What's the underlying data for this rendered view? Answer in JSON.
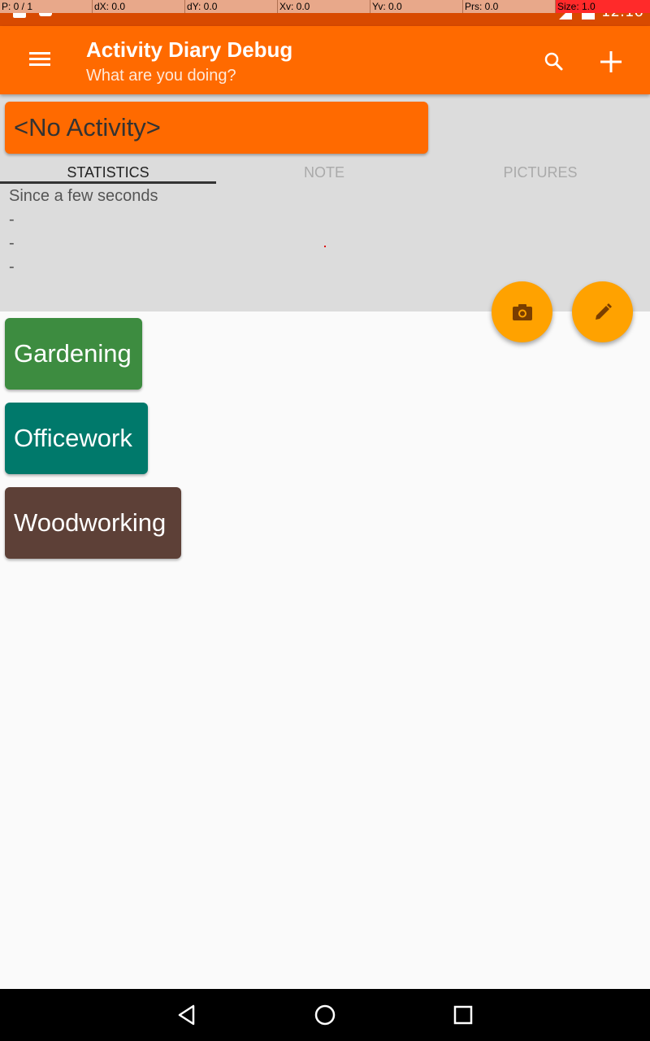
{
  "debug": {
    "cells": [
      "P: 0 / 1",
      "dX: 0.0",
      "dY: 0.0",
      "Xv: 0.0",
      "Yv: 0.0",
      "Prs: 0.0",
      "Size: 1.0"
    ]
  },
  "status_bar": {
    "time": "12:16"
  },
  "app_bar": {
    "title": "Activity Diary Debug",
    "subtitle": "What are you doing?",
    "menu_icon": "menu-icon",
    "search_icon": "search-icon",
    "add_icon": "add-icon"
  },
  "current": {
    "activity": "<No Activity>",
    "color": "#ff6a00"
  },
  "tabs": [
    {
      "label": "STATISTICS",
      "active": true
    },
    {
      "label": "NOTE",
      "active": false
    },
    {
      "label": "PICTURES",
      "active": false
    }
  ],
  "stats": [
    "Since a few seconds",
    "-",
    "-",
    "-"
  ],
  "fabs": {
    "camera_icon": "camera-icon",
    "edit_icon": "edit-icon"
  },
  "activities": [
    {
      "name": "Gardening",
      "color": "#3d8c40"
    },
    {
      "name": "Officework",
      "color": "#00796b"
    },
    {
      "name": "Woodworking",
      "color": "#5d4037"
    }
  ],
  "nav": {
    "back": "back-icon",
    "home": "home-icon",
    "recents": "recents-icon"
  }
}
